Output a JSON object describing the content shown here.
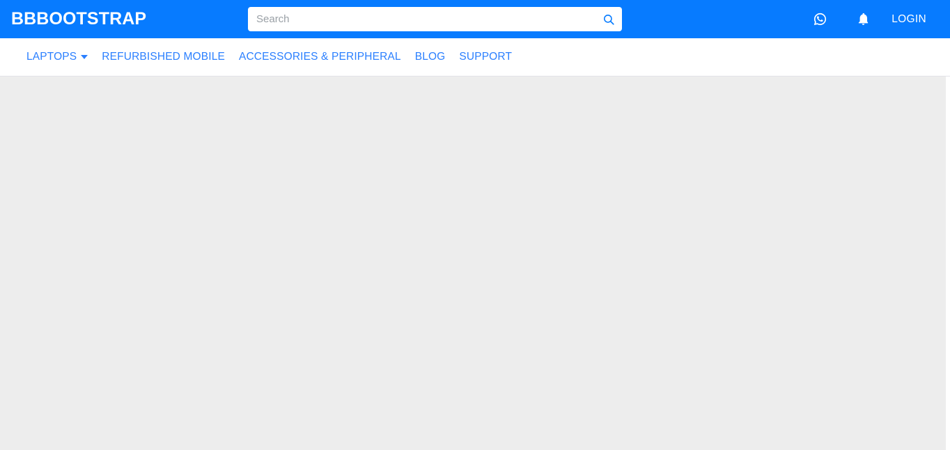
{
  "header": {
    "brand": "BBBOOTSTRAP",
    "background_color": "#077bff",
    "search": {
      "placeholder": "Search",
      "value": "",
      "icon": "search-icon"
    },
    "actions": [
      {
        "name": "whatsapp-icon",
        "label": "WhatsApp"
      },
      {
        "name": "bell-icon",
        "label": "Notifications"
      }
    ],
    "login_label": "LOGIN"
  },
  "navbar": {
    "link_color": "#2a7fff",
    "items": [
      {
        "label": "LAPTOPS",
        "has_dropdown": true
      },
      {
        "label": "REFURBISHED MOBILE",
        "has_dropdown": false
      },
      {
        "label": "ACCESSORIES & PERIPHERAL",
        "has_dropdown": false
      },
      {
        "label": "BLOG",
        "has_dropdown": false
      },
      {
        "label": "SUPPORT",
        "has_dropdown": false
      }
    ]
  },
  "main": {
    "background_color": "#ededed",
    "content": ""
  }
}
